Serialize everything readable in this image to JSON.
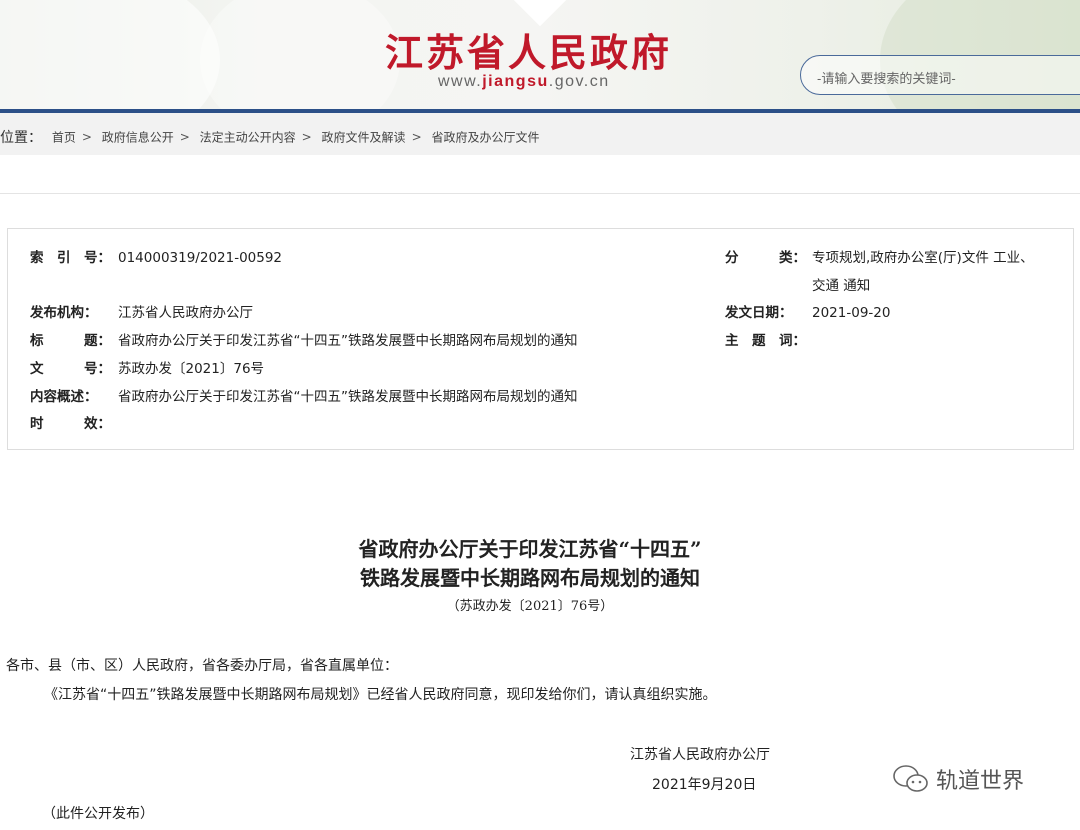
{
  "header": {
    "site_title": "江苏省人民政府",
    "url_prefix": "www.",
    "url_brand": "jiangsu",
    "url_suffix": ".gov.cn",
    "search_placeholder": "-请输入要搜索的关键词-"
  },
  "breadcrumb": {
    "label": "位置：",
    "items": [
      "首页",
      "政府信息公开",
      "法定主动公开内容",
      "政府文件及解读",
      "省政府及办公厅文件"
    ]
  },
  "info": {
    "index_label": "索　引　号：",
    "index": "014000319/2021-00592",
    "publisher_label": "发布机构：",
    "publisher": "江苏省人民政府办公厅",
    "title_label": "标　　　题：",
    "title": "省政府办公厅关于印发江苏省“十四五”铁路发展暨中长期路网布局规划的通知",
    "docno_label": "文　　　号：",
    "docno": "苏政办发〔2021〕76号",
    "summary_label": "内容概述：",
    "summary": "省政府办公厅关于印发江苏省“十四五”铁路发展暨中长期路网布局规划的通知",
    "validity_label": "时　　　效：",
    "validity": "",
    "category_label": "分　　　类：",
    "category_line1": "专项规划,政府办公室(厅)文件 工业、",
    "category_line2": "交通 通知",
    "date_label": "发文日期：",
    "date": "2021-09-20",
    "keywords_label": "主　题　词：",
    "keywords": ""
  },
  "document": {
    "title_line1": "省政府办公厅关于印发江苏省“十四五”",
    "title_line2": "铁路发展暨中长期路网布局规划的通知",
    "doc_number": "（苏政办发〔2021〕76号）",
    "salutation": "各市、县（市、区）人民政府，省各委办厅局，省各直属单位：",
    "body": "《江苏省“十四五”铁路发展暨中长期路网布局规划》已经省人民政府同意，现印发给你们，请认真组织实施。",
    "signature": "江苏省人民政府办公厅",
    "sign_date": "2021年9月20日",
    "footer_note": "（此件公开发布）"
  },
  "watermark": {
    "icon": "wechat-icon",
    "text": "轨道世界"
  },
  "colors": {
    "brand_red": "#c0192a",
    "nav_blue": "#2c5088"
  }
}
